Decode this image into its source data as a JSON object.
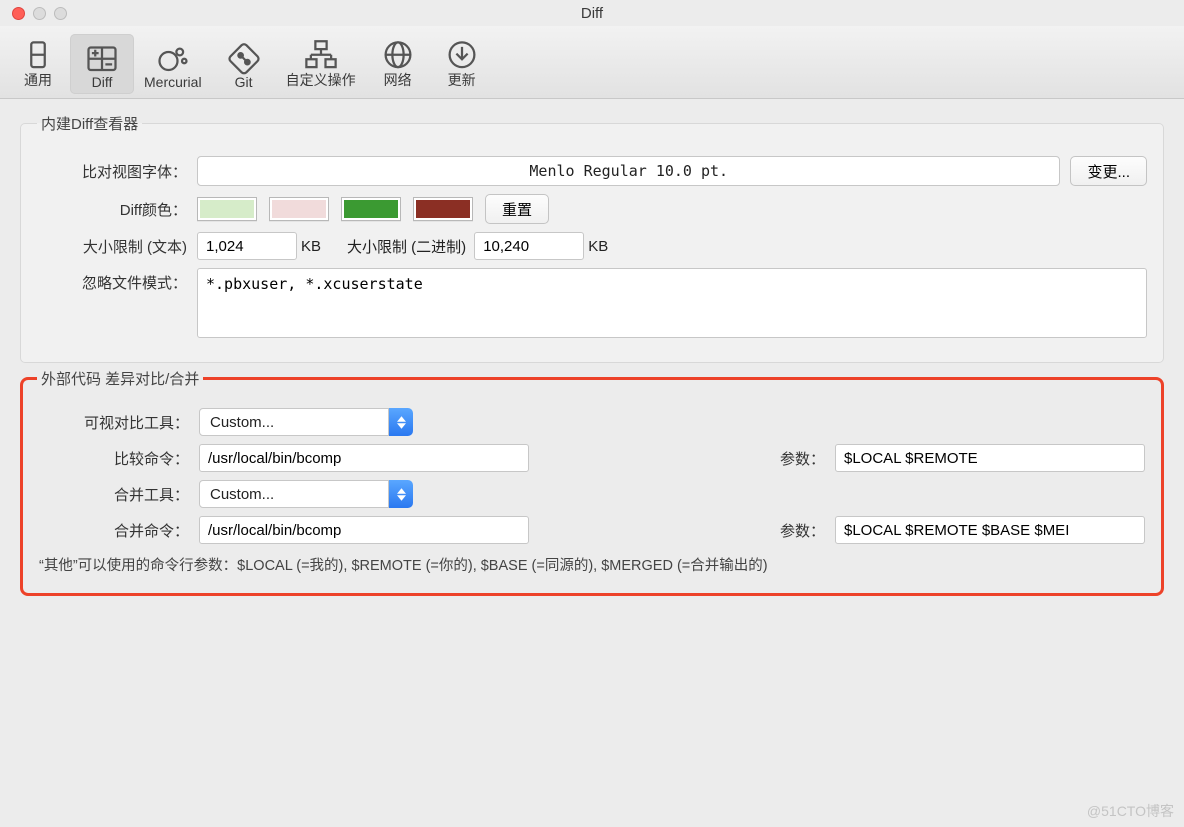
{
  "window": {
    "title": "Diff"
  },
  "toolbar": {
    "items": [
      {
        "label": "通用"
      },
      {
        "label": "Diff"
      },
      {
        "label": "Mercurial"
      },
      {
        "label": "Git"
      },
      {
        "label": "自定义操作"
      },
      {
        "label": "网络"
      },
      {
        "label": "更新"
      }
    ]
  },
  "internal": {
    "legend": "内建Diff查看器",
    "font_label": "比对视图字体：",
    "font_value": "Menlo Regular 10.0 pt.",
    "change_btn": "变更...",
    "colors_label": "Diff颜色：",
    "colors": [
      "#d6ecc9",
      "#f1dbdb",
      "#3b9a32",
      "#8b2f24"
    ],
    "reset_btn": "重置",
    "size_text_label": "大小限制 (文本)",
    "size_text_value": "1,024",
    "size_bin_label": "大小限制 (二进制)",
    "size_bin_value": "10,240",
    "unit": "KB",
    "ignore_label": "忽略文件模式：",
    "ignore_value": "*.pbxuser, *.xcuserstate"
  },
  "external": {
    "legend": "外部代码 差异对比/合并",
    "diff_tool_label": "可视对比工具：",
    "diff_tool_value": "Custom...",
    "diff_cmd_label": "比较命令：",
    "diff_cmd_value": "/usr/local/bin/bcomp",
    "diff_args_label": "参数：",
    "diff_args_value": "$LOCAL $REMOTE",
    "merge_tool_label": "合并工具：",
    "merge_tool_value": "Custom...",
    "merge_cmd_label": "合并命令：",
    "merge_cmd_value": "/usr/local/bin/bcomp",
    "merge_args_label": "参数：",
    "merge_args_value": "$LOCAL $REMOTE $BASE $MEI",
    "hint": "“其他”可以使用的命令行参数：$LOCAL (=我的), $REMOTE (=你的), $BASE (=同源的), $MERGED (=合并输出的)"
  },
  "watermark": "@51CTO博客"
}
